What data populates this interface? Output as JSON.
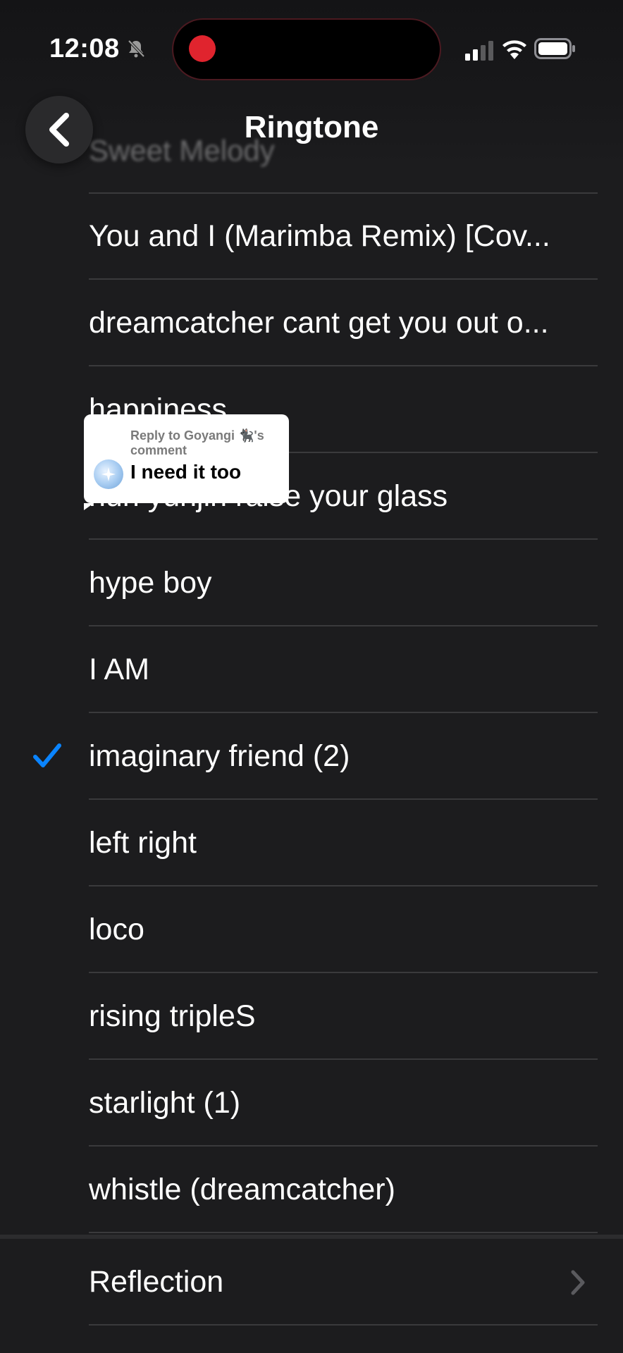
{
  "status_bar": {
    "time": "12:08",
    "icons": [
      "mute-bell-icon",
      "signal-icon",
      "wifi-icon",
      "battery-icon"
    ],
    "recording_indicator_color": "#e0242e"
  },
  "nav": {
    "title": "Ringtone",
    "back_icon": "chevron-left-icon",
    "ghost_previous_row": "Sweet Melody"
  },
  "ringtones": [
    {
      "label": "You and I (Marimba Remix) [Cov...",
      "selected": false
    },
    {
      "label": "dreamcatcher cant get you out o...",
      "selected": false
    },
    {
      "label": "happiness",
      "selected": false
    },
    {
      "label": "huh yunjin raise your glass",
      "selected": false
    },
    {
      "label": "hype boy",
      "selected": false
    },
    {
      "label": "I AM",
      "selected": false
    },
    {
      "label": "imaginary friend (2)",
      "selected": true
    },
    {
      "label": "left right",
      "selected": false
    },
    {
      "label": "loco",
      "selected": false
    },
    {
      "label": "rising tripleS",
      "selected": false
    },
    {
      "label": "starlight (1)",
      "selected": false
    },
    {
      "label": "whistle (dreamcatcher)",
      "selected": false
    }
  ],
  "selection_color": "#0a84ff",
  "comment_overlay": {
    "reply_to": "Reply to Goyangi 🐈‍⬛'s comment",
    "text": "I need it too"
  },
  "reflection": {
    "label": "Reflection",
    "icon": "chevron-right-icon"
  }
}
